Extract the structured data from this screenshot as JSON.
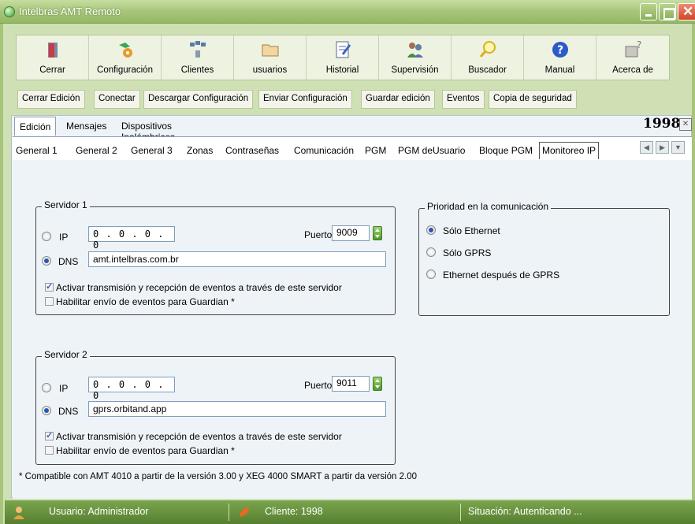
{
  "window": {
    "title": "Intelbras AMT Remoto"
  },
  "toolbar": {
    "items": [
      {
        "label": "Cerrar",
        "icon": "door-icon"
      },
      {
        "label": "Configuración",
        "icon": "config-icon"
      },
      {
        "label": "Clientes",
        "icon": "clients-icon"
      },
      {
        "label": "usuarios",
        "icon": "folder-icon"
      },
      {
        "label": "Historial",
        "icon": "history-icon"
      },
      {
        "label": "Supervisión",
        "icon": "supervision-icon"
      },
      {
        "label": "Buscador",
        "icon": "search-icon"
      },
      {
        "label": "Manual",
        "icon": "help-icon"
      },
      {
        "label": "Acerca de",
        "icon": "about-icon"
      }
    ]
  },
  "actions": [
    "Cerrar Edición",
    "Conectar",
    "Descargar Configuración",
    "Enviar Configuración",
    "Guardar edición",
    "Eventos",
    "Copia de seguridad"
  ],
  "panel_tabs": [
    "Edición",
    "Mensajes",
    "Dispositivos Inalámbricos"
  ],
  "account_number": "1998",
  "sub_tabs": [
    "General 1",
    "General 2",
    "General 3",
    "Zonas",
    "Contraseñas",
    "Comunicación",
    "PGM",
    "PGM deUsuario",
    "Bloque PGM",
    "Monitoreo IP"
  ],
  "servidor1": {
    "title": "Servidor 1",
    "ip_label": "IP",
    "ip_value": "0 . 0 . 0 . 0",
    "puerto_label": "Puerto",
    "puerto_value": "9009",
    "dns_label": "DNS",
    "dns_value": "amt.intelbras.com.br",
    "check1": "Activar transmisión y recepción de eventos a través de este servidor",
    "check2": "Habilitar envío de eventos para  Guardian *"
  },
  "servidor2": {
    "title": "Servidor 2",
    "ip_label": "IP",
    "ip_value": "0 . 0 . 0 . 0",
    "puerto_label": "Puerto",
    "puerto_value": "9011",
    "dns_label": "DNS",
    "dns_value": "gprs.orbitand.app",
    "check1": "Activar transmisión y recepción de eventos a través de este servidor",
    "check2": "Habilitar envío de eventos para  Guardian *"
  },
  "prioridad": {
    "title": "Prioridad en la comunicación",
    "options": [
      "Sólo Ethernet",
      "Sólo GPRS",
      "Ethernet después de GPRS"
    ],
    "selected": "Sólo Ethernet"
  },
  "footnote": "* Compatible con AMT 4010 a partir de la versión 3.00 y XEG 4000 SMART a partir da versión 2.00",
  "status": {
    "usuario": "Usuario: Administrador",
    "cliente": "Cliente: 1998",
    "situacion": "Situación: Autenticando ..."
  }
}
